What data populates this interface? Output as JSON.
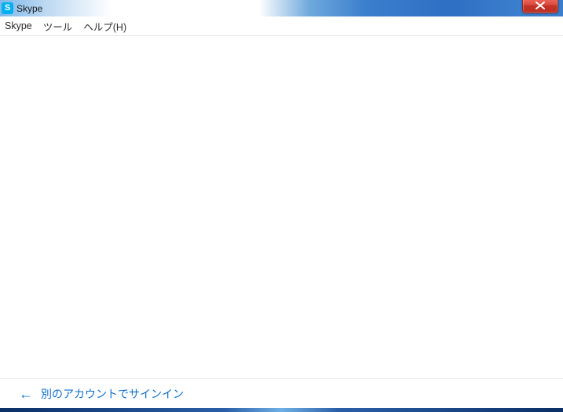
{
  "window": {
    "title": "Skype",
    "icon_letter": "S"
  },
  "menu": {
    "items": [
      "Skype",
      "ツール",
      "ヘルプ(H)"
    ]
  },
  "footer": {
    "signin_other": "別のアカウントでサインイン"
  }
}
